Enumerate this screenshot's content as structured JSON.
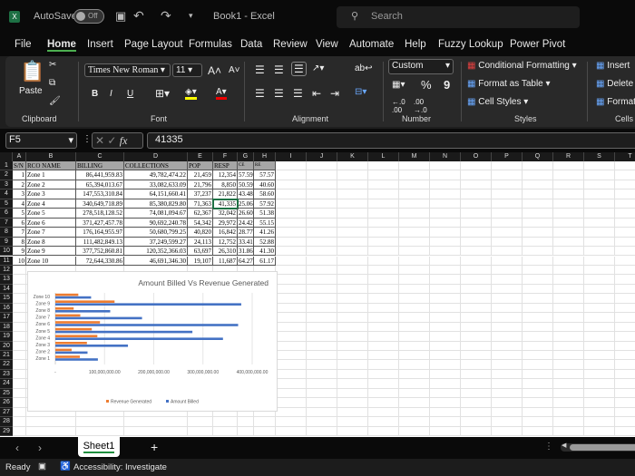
{
  "titlebar": {
    "autosave": "AutoSave",
    "toggle": "Off",
    "title": "Book1  -  Excel",
    "search": "Search"
  },
  "menu": [
    "File",
    "Home",
    "Insert",
    "Page Layout",
    "Formulas",
    "Data",
    "Review",
    "View",
    "Automate",
    "Help",
    "Fuzzy Lookup",
    "Power Pivot"
  ],
  "ribbon": {
    "paste": "Paste",
    "clipboard": "Clipboard",
    "font_name": "Times New Roman",
    "font_size": "11",
    "font": "Font",
    "alignment": "Alignment",
    "number_format": "Custom",
    "number": "Number",
    "cond_format": "Conditional Formatting",
    "format_table": "Format as Table",
    "cell_styles": "Cell Styles",
    "styles": "Styles",
    "insert": "Insert",
    "delete": "Delete",
    "format": "Format",
    "cells": "Cells",
    "bold": "B",
    "italic": "I",
    "underline": "U",
    "percent": "%",
    "comma": "9"
  },
  "formula": {
    "namebox": "F5",
    "value": "41335",
    "fx": "fx"
  },
  "columns": [
    "A",
    "B",
    "C",
    "D",
    "E",
    "F",
    "G",
    "H",
    "I",
    "J",
    "K",
    "L",
    "M",
    "N",
    "O",
    "P",
    "Q",
    "R",
    "S",
    "T"
  ],
  "table": {
    "headers": [
      "S/N",
      "RCO NAME",
      "BILLING",
      "COLLECTIONS",
      "POP",
      "RESP",
      "CE",
      "RE"
    ],
    "rows": [
      [
        "1",
        "Zone 1",
        "86,441,959.83",
        "49,782,474.22",
        "21,459",
        "12,354",
        "57.59",
        "57.57"
      ],
      [
        "2",
        "Zone 2",
        "65,394,013.67",
        "33,082,633.09",
        "21,796",
        "8,850",
        "50.59",
        "40.60"
      ],
      [
        "3",
        "Zone 3",
        "147,553,310.84",
        "64,151,660.41",
        "37,237",
        "21,822",
        "43.48",
        "58.60"
      ],
      [
        "4",
        "Zone 4",
        "340,649,718.89",
        "85,380,829.80",
        "71,363",
        "41,335",
        "25.06",
        "57.92"
      ],
      [
        "5",
        "Zone 5",
        "278,518,128.52",
        "74,081,094.67",
        "62,367",
        "32,042",
        "26.60",
        "51.38"
      ],
      [
        "6",
        "Zone 6",
        "371,427,457.78",
        "90,692,240.78",
        "54,342",
        "29,972",
        "24.42",
        "55.15"
      ],
      [
        "7",
        "Zone 7",
        "176,164,955.97",
        "50,680,799.25",
        "40,820",
        "16,842",
        "28.77",
        "41.26"
      ],
      [
        "8",
        "Zone 8",
        "111,482,849.13",
        "37,249,599.27",
        "24,113",
        "12,752",
        "33.41",
        "52.88"
      ],
      [
        "9",
        "Zone 9",
        "377,752,860.81",
        "120,352,366.03",
        "63,697",
        "26,310",
        "31.86",
        "41.30"
      ],
      [
        "10",
        "Zone 10",
        "72,644,330.86",
        "46,691,346.30",
        "19,107",
        "11,687",
        "64.27",
        "61.17"
      ]
    ]
  },
  "chart_data": {
    "type": "bar",
    "orientation": "horizontal",
    "title": "Amount Billed Vs Revenue Generated",
    "categories": [
      "Zone 1",
      "Zone 2",
      "Zone 3",
      "Zone 4",
      "Zone 5",
      "Zone 6",
      "Zone 7",
      "Zone 8",
      "Zone 9",
      "Zone 10"
    ],
    "series": [
      {
        "name": "Revenue Generated",
        "color": "#ed7d31",
        "values": [
          49782474.22,
          33082633.09,
          64151660.41,
          85380829.8,
          74081094.67,
          90692240.78,
          50680799.25,
          37249599.27,
          120352366.03,
          46691346.3
        ]
      },
      {
        "name": "Amount Billed",
        "color": "#4472c4",
        "values": [
          86441959.83,
          65394013.67,
          147553310.84,
          340649718.89,
          278518128.52,
          371427457.78,
          176164955.97,
          111482849.13,
          377752860.81,
          72644330.86
        ]
      }
    ],
    "xlim": [
      0,
      400000000
    ],
    "xticks": [
      "-",
      "100,000,000.00",
      "200,000,000.00",
      "300,000,000.00",
      "400,000,000.00"
    ],
    "legend": "bottom",
    "grid": true
  },
  "sheets": {
    "active": "Sheet1",
    "add": "+"
  },
  "status": {
    "ready": "Ready",
    "accessibility": "Accessibility: Investigate"
  }
}
